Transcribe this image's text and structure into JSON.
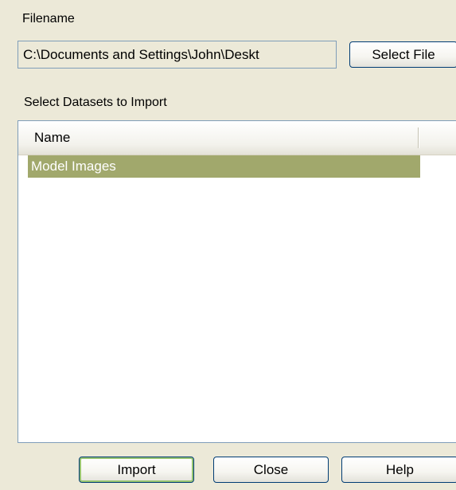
{
  "filename": {
    "label": "Filename",
    "value": "C:\\Documents and Settings\\John\\Deskt",
    "select_button": "Select File"
  },
  "datasets": {
    "label": "Select Datasets to Import",
    "columns": [
      "Name"
    ],
    "rows": [
      {
        "name": "Model Images",
        "selected": true
      }
    ]
  },
  "buttons": {
    "import": "Import",
    "close": "Close",
    "help": "Help"
  },
  "colors": {
    "dialog_bg": "#ece9d8",
    "selection": "#a1a86c",
    "border": "#7f9db9"
  }
}
